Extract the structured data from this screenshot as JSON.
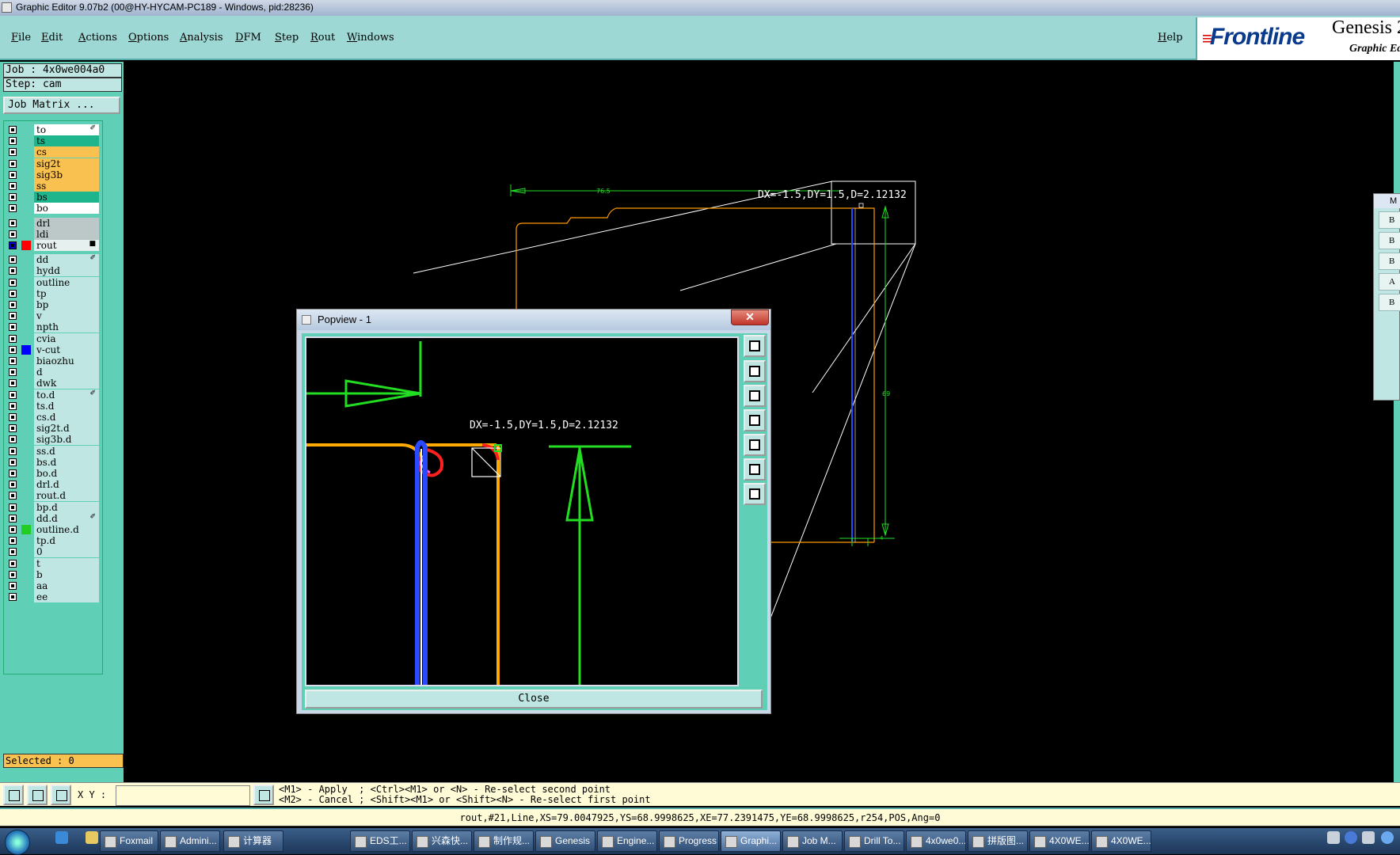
{
  "window": {
    "title": "Graphic Editor 9.07b2 (00@HY-HYCAM-PC189 - Windows, pid:28236)"
  },
  "menubar": {
    "items": [
      "File",
      "Edit",
      "Actions",
      "Options",
      "Analysis",
      "DFM",
      "Step",
      "Rout",
      "Windows"
    ],
    "help": "Help"
  },
  "brand": {
    "logo": "Frontline",
    "product": "Genesis 2",
    "subtitle": "Graphic Ed"
  },
  "job": {
    "job_line": "Job : 4x0we004a0",
    "step_line": "Step: cam",
    "matrix_button": "Job Matrix ..."
  },
  "layers": [
    {
      "name": "to",
      "bg": "#ffffff",
      "tag": "✐"
    },
    {
      "name": "ts",
      "bg": "#1fb58c"
    },
    {
      "name": "cs",
      "bg": "#f8c150"
    },
    {
      "name": "sig2t",
      "bg": "#f8c150"
    },
    {
      "name": "sig3b",
      "bg": "#f8c150"
    },
    {
      "name": "ss",
      "bg": "#f8c150"
    },
    {
      "name": "bs",
      "bg": "#1fb58c"
    },
    {
      "name": "bo",
      "bg": "#ffffff"
    },
    {
      "name": "drl",
      "bg": "#bcc8c8"
    },
    {
      "name": "ldi",
      "bg": "#bcc8c8"
    },
    {
      "name": "rout",
      "bg": "#e6f0ef",
      "swatch": "#ff0000",
      "tag": "■",
      "work": true
    },
    {
      "name": "dd",
      "tag": "✐"
    },
    {
      "name": "hydd"
    },
    {
      "name": "outline"
    },
    {
      "name": "tp"
    },
    {
      "name": "bp"
    },
    {
      "name": "v"
    },
    {
      "name": "npth"
    },
    {
      "name": "cvia"
    },
    {
      "name": "v-cut",
      "swatch": "#0000ff"
    },
    {
      "name": "biaozhu"
    },
    {
      "name": "d"
    },
    {
      "name": "dwk"
    },
    {
      "name": "to.d",
      "tag": "✐"
    },
    {
      "name": "ts.d"
    },
    {
      "name": "cs.d"
    },
    {
      "name": "sig2t.d"
    },
    {
      "name": "sig3b.d"
    },
    {
      "name": "ss.d"
    },
    {
      "name": "bs.d"
    },
    {
      "name": "bo.d"
    },
    {
      "name": "drl.d"
    },
    {
      "name": "rout.d"
    },
    {
      "name": "bp.d"
    },
    {
      "name": "dd.d",
      "tag": "✐"
    },
    {
      "name": "outline.d",
      "swatch": "#22cc22"
    },
    {
      "name": "tp.d"
    },
    {
      "name": "0"
    },
    {
      "name": "t"
    },
    {
      "name": "b"
    },
    {
      "name": "aa"
    },
    {
      "name": "ee"
    }
  ],
  "selected": "Selected : 0",
  "canvas": {
    "measure_text": "DX=-1.5,DY=1.5,D=2.12132",
    "dim_top": "76.5",
    "dim_right": "69",
    "dim_bottom": "4",
    "colors": {
      "green": "#22dd22",
      "orange": "#ff9900",
      "blue": "#2a4aff",
      "white": "#ffffff"
    }
  },
  "popview": {
    "title": "Popview - 1",
    "measure_text": "DX=-1.5,DY=1.5,D=2.12132",
    "close_label": "Close",
    "tools": [
      "zoom-window-icon",
      "pan-up-icon",
      "pan-down-icon",
      "pan-left-icon",
      "pan-right-icon",
      "zoom-fit-icon",
      "zoom-home-icon"
    ]
  },
  "right_widget": {
    "title": "M",
    "rows": [
      "B",
      "B",
      "B",
      "A",
      "B"
    ]
  },
  "cmd": {
    "xy_label": "X Y :",
    "xy_value": "",
    "hint_line1": "<M1> - Apply  ; <Ctrl><M1> or <N> - Re-select second point",
    "hint_line2": "<M2> - Cancel ; <Shift><M1> or <Shift><N> - Re-select first point"
  },
  "status": "rout,#21,Line,XS=79.0047925,YS=68.9998625,XE=77.2391475,YE=68.9998625,r254,POS,Ang=0",
  "taskbar": {
    "items": [
      {
        "label": "Foxmail",
        "w": 74
      },
      {
        "label": "Admini...",
        "w": 76
      },
      {
        "label": "计算器",
        "w": 76
      },
      {
        "label": "EDS工...",
        "w": 76
      },
      {
        "label": "兴森快...",
        "w": 76
      },
      {
        "label": "制作规...",
        "w": 76
      },
      {
        "label": "Genesis",
        "w": 76
      },
      {
        "label": "Engine...",
        "w": 76
      },
      {
        "label": "Progress",
        "w": 76
      },
      {
        "label": "Graphi...",
        "w": 76,
        "active": true
      },
      {
        "label": "Job M...",
        "w": 76
      },
      {
        "label": "Drill To...",
        "w": 76
      },
      {
        "label": "4x0we0...",
        "w": 76
      },
      {
        "label": "拼版图...",
        "w": 76
      },
      {
        "label": "4X0WE...",
        "w": 76
      },
      {
        "label": "4X0WE...",
        "w": 76
      }
    ]
  }
}
